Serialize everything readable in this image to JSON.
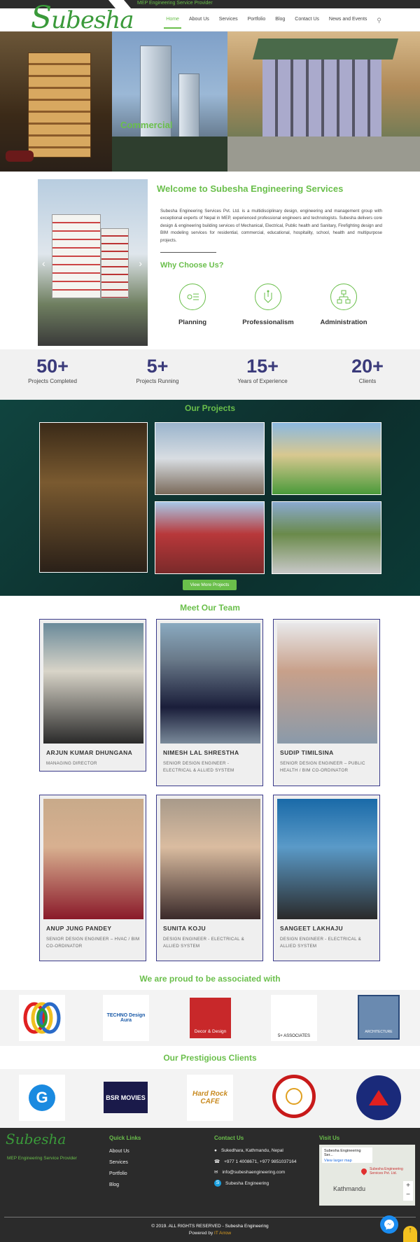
{
  "topbar": {
    "tagline": "MEP Engineering Service Provider"
  },
  "header": {
    "logo_initial": "S",
    "logo_rest": "ubesha",
    "nav": [
      "Home",
      "About Us",
      "Services",
      "Portfolio",
      "Blog",
      "Contact Us",
      "News and Events"
    ],
    "search_icon": "search-icon"
  },
  "hero": {
    "caption": "Commercial"
  },
  "welcome": {
    "title": "Welcome to Subesha Engineering Services",
    "intro": "Subesha Engineering Services Pvt. Ltd.  is a multidisciplinary design, engineering and management group with exceptional experts of Nepal in MEP, experienced professional engineers and technologists. Subesha delivers core design & engineering building services of Mechanical, Electrical, Public health and Sanitary, Firefighting design and BIM modeling services for residential, commercial, educational, hospitality, school, health and multipurpose projects.",
    "why_title": "Why Choose Us?",
    "why": [
      "Planning",
      "Professionalism",
      "Administration"
    ],
    "prev": "‹",
    "next": "›"
  },
  "stats": [
    {
      "num": "50+",
      "label": "Projects Completed"
    },
    {
      "num": "5+",
      "label": "Projects Running"
    },
    {
      "num": "15+",
      "label": "Years of Experience"
    },
    {
      "num": "20+",
      "label": "Clients"
    }
  ],
  "projects": {
    "title": "Our Projects",
    "button": "View More Projects"
  },
  "team": {
    "title": "Meet Our Team",
    "members": [
      {
        "name": "ARJUN KUMAR DHUNGANA",
        "role": "MANAGING DIRECTOR"
      },
      {
        "name": "NIMESH LAL SHRESTHA",
        "role": "SENIOR DESIGN ENGINEER - ELECTRICAL & ALLIED SYSTEM"
      },
      {
        "name": "SUDIP TIMILSINA",
        "role": "SENIOR DESIGN ENGINEER – PUBLIC HEALTH / BIM CO-ORDINATOR"
      },
      {
        "name": "ANUP JUNG PANDEY",
        "role": "SENIOR DESIGN ENGINEER – HVAC / BIM CO-ORDINATOR"
      },
      {
        "name": "SUNITA KOJU",
        "role": "DESIGN ENGINEER - ELECTRICAL & ALLIED SYSTEM"
      },
      {
        "name": "SANGEET LAKHAJU",
        "role": "DESIGN ENGINEER - ELECTRICAL & ALLIED SYSTEM"
      }
    ]
  },
  "associates": {
    "title": "We are proud to be associated with",
    "logos": [
      "",
      "TECHNO Design Aura",
      "Decor & Design",
      "5+ ASSOCIATES",
      "ARCHITECTURE"
    ]
  },
  "clients": {
    "title": "Our Prestigious Clients",
    "logos": [
      "G",
      "BSR MOVIES",
      "Hard Rock CAFE",
      "",
      ""
    ]
  },
  "footer": {
    "logo": "Subesha",
    "tagline": "MEP Engineering Service Provider",
    "quick_title": "Quick Links",
    "quick": [
      "About Us",
      "Services",
      "Portfolio",
      "Blog"
    ],
    "contact_title": "Contact Us",
    "address": "Sukedhara, Kathmandu, Nepal",
    "phone": "+977 1 4008671, +977 9851037164",
    "email": "info@subeshaengineering.com",
    "skype": "Subesha Engineering",
    "visit_title": "Visit Us",
    "map_place": "Subesha Engineering Ser...",
    "map_link": "View larger map",
    "map_pin": "Subesha Engineering Services Pvt. Ltd.",
    "map_city": "Kathmandu",
    "copyright": "© 2019. ALL RIGHTS RESERVED - Subesha Engineering",
    "powered_prefix": "Powered by",
    "powered_by": "IT Arrow"
  }
}
